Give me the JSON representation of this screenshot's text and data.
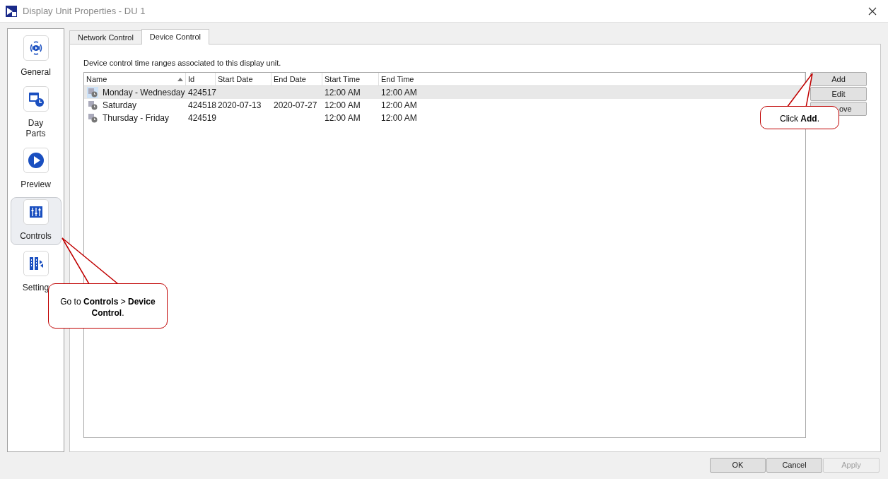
{
  "window": {
    "title": "Display Unit Properties - DU 1"
  },
  "sidebar": {
    "items": [
      {
        "label": "General",
        "selected": false,
        "kind": "broadcast"
      },
      {
        "label": "Day\nParts",
        "selected": false,
        "kind": "calendar"
      },
      {
        "label": "Preview",
        "selected": false,
        "kind": "play"
      },
      {
        "label": "Controls",
        "selected": true,
        "kind": "sliders"
      },
      {
        "label": "Setting",
        "selected": false,
        "kind": "settings"
      }
    ]
  },
  "tabs": [
    {
      "label": "Network Control",
      "selected": false
    },
    {
      "label": "Device Control",
      "selected": true
    }
  ],
  "description": "Device control time ranges associated to this display unit.",
  "table": {
    "columns": [
      {
        "label": "Name",
        "sorted": true
      },
      {
        "label": "Id",
        "sorted": false
      },
      {
        "label": "Start Date",
        "sorted": false
      },
      {
        "label": "End Date",
        "sorted": false
      },
      {
        "label": "Start Time",
        "sorted": false
      },
      {
        "label": "End Time",
        "sorted": false
      }
    ],
    "rows": [
      {
        "selected": true,
        "cells": [
          "Monday - Wednesday",
          "424517",
          "",
          "",
          "12:00 AM",
          "12:00 AM"
        ]
      },
      {
        "selected": false,
        "cells": [
          "Saturday",
          "424518",
          "2020-07-13",
          "2020-07-27",
          "12:00 AM",
          "12:00 AM"
        ]
      },
      {
        "selected": false,
        "cells": [
          "Thursday - Friday",
          "424519",
          "",
          "",
          "12:00 AM",
          "12:00 AM"
        ]
      }
    ]
  },
  "side_buttons": [
    {
      "label": "Add"
    },
    {
      "label": "Edit"
    },
    {
      "label": "ove"
    }
  ],
  "footer_buttons": [
    {
      "label": "OK",
      "disabled": false
    },
    {
      "label": "Cancel",
      "disabled": false
    },
    {
      "label": "Apply",
      "disabled": true
    }
  ],
  "callouts": [
    {
      "text": "Go to **Controls** > **Device Control**.",
      "kind": "left"
    },
    {
      "text": "Click **Add**.",
      "kind": "right"
    }
  ]
}
